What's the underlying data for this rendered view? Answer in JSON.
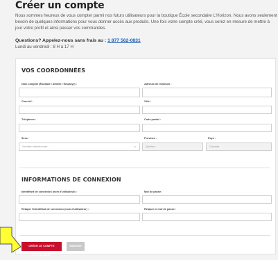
{
  "page": {
    "title": "Créer un compte",
    "intro": "Nous sommes heureux de vous compter parmi nos futurs utilisateurs pour la boutique École secondaire L'Horizon. Nous avons seulement besoin de quelques informations pour vous donner accès aux produits. Une fois votre compte créé, vous serez en mesure de mettre à jour votre profil et ainsi passer vos commandes.",
    "phone_prompt": "Questions? Appelez-nous sans frais au : ",
    "phone_number": "1 877 562-0831",
    "hours": "Lundi au vendredi : 8 H à 17 H"
  },
  "contact": {
    "section_title": "VOS COORDONNÉES",
    "full_name_label": "Nom complet (Étudiant / Athlète / Employé) :",
    "delivery_address_label": "Adresse de livraison :",
    "email_label": "Courriel :",
    "city_label": "Ville :",
    "phone_label": "Téléphone :",
    "postal_code_label": "Code postal :",
    "sex_label": "Sexe :",
    "sex_placeholder": "Veuillez sélectionner...",
    "province_label": "Province :",
    "province_value": "Québec",
    "country_label": "Pays :",
    "country_value": "Canada"
  },
  "login": {
    "section_title": "INFORMATIONS DE CONNEXION",
    "username_label": "Identifiant de connexion (nom d'utilisateur) :",
    "password_label": "Mot de passe :",
    "confirm_username_label": "Retaper l'identifiant de connexion (nom d'utilisateur) :",
    "confirm_password_label": "Retaper le mot de passe :"
  },
  "actions": {
    "create_label": "CRÉER LE COMPTE UTILISATEUR",
    "cancel_label": "ANNULER"
  },
  "colors": {
    "primary": "#c8102e",
    "link": "#1a5fb4",
    "pointer": "#ffff33"
  }
}
